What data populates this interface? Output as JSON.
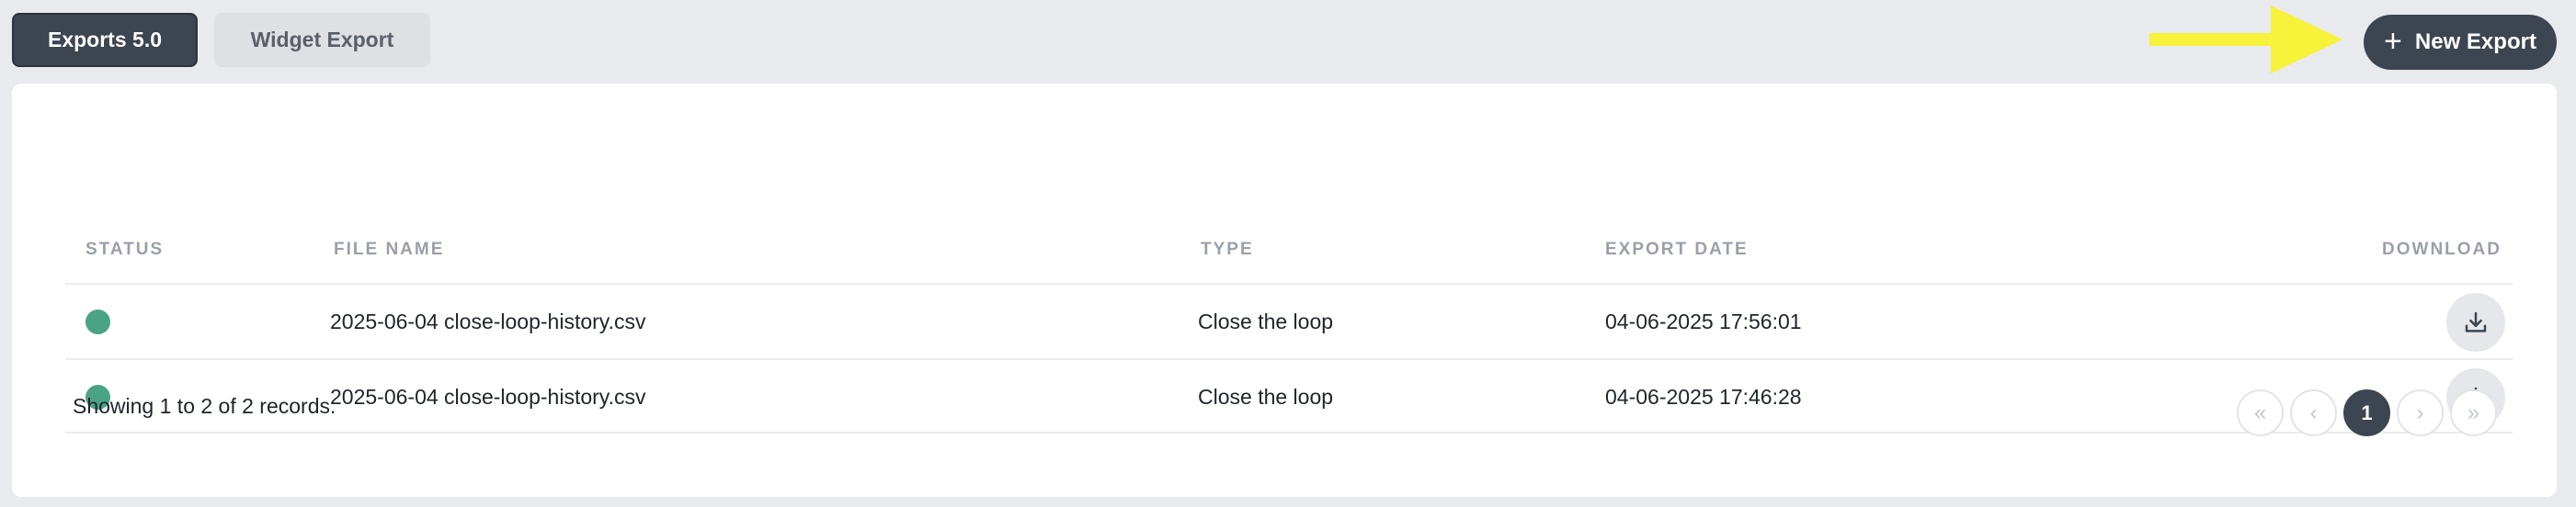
{
  "tabs": [
    {
      "label": "Exports 5.0",
      "active": true
    },
    {
      "label": "Widget Export",
      "active": false
    }
  ],
  "header": {
    "new_export_label": "New Export",
    "new_export_icon": "plus-icon",
    "annotation_arrow_color": "#f7f23a"
  },
  "table": {
    "columns": {
      "status": "STATUS",
      "file_name": "FILE NAME",
      "type": "TYPE",
      "export_date": "EXPORT DATE",
      "download": "DOWNLOAD"
    },
    "rows": [
      {
        "status": "completed",
        "status_color": "#4aa384",
        "file_name": "2025-06-04 close-loop-history.csv",
        "type": "Close the loop",
        "export_date": "04-06-2025 17:56:01",
        "download_icon": "download-icon"
      },
      {
        "status": "completed",
        "status_color": "#4aa384",
        "file_name": "2025-06-04 close-loop-history.csv",
        "type": "Close the loop",
        "export_date": "04-06-2025 17:46:28",
        "download_icon": "download-icon"
      }
    ]
  },
  "footer": {
    "records_text": "Showing 1 to 2 of 2 records.",
    "pagination": {
      "first": "«",
      "prev": "‹",
      "current_page": "1",
      "next": "›",
      "last": "»"
    }
  },
  "colors": {
    "primary_dark": "#3d4550",
    "status_success": "#4aa384",
    "page_bg": "#e9eaed"
  }
}
